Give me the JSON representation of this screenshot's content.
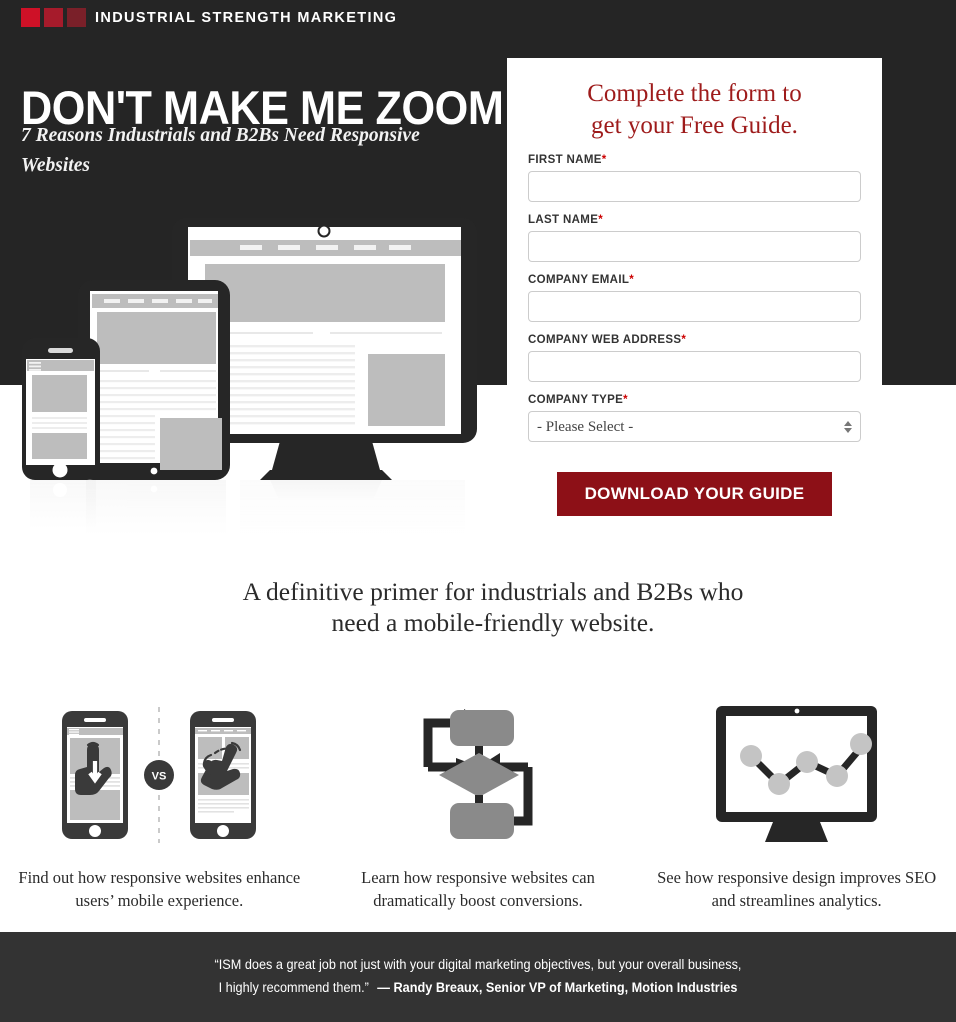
{
  "brand": {
    "name": "INDUSTRIAL STRENGTH MARKETING",
    "square_colors": [
      "#CE1127",
      "#A61B2B",
      "#7A2029"
    ],
    "header_bg": "#252525",
    "accent_red": "#9E1B1B",
    "button_red": "#8D1017",
    "footer_bg": "#333333"
  },
  "hero": {
    "title": "DON'T MAKE ME ZOOM",
    "subtitle": "7 Reasons Industrials and B2Bs Need Responsive Websites",
    "illustration_name": "responsive-devices-illustration"
  },
  "form": {
    "heading_line1": "Complete the form to",
    "heading_line2": "get your Free Guide.",
    "fields": [
      {
        "label": "FIRST NAME",
        "required": true,
        "type": "text",
        "value": "",
        "placeholder": ""
      },
      {
        "label": "LAST NAME",
        "required": true,
        "type": "text",
        "value": "",
        "placeholder": ""
      },
      {
        "label": "COMPANY EMAIL",
        "required": true,
        "type": "text",
        "value": "",
        "placeholder": ""
      },
      {
        "label": "COMPANY WEB ADDRESS",
        "required": true,
        "type": "text",
        "value": "",
        "placeholder": ""
      },
      {
        "label": "COMPANY TYPE",
        "required": true,
        "type": "select",
        "value": "- Please Select -",
        "placeholder": ""
      }
    ],
    "required_marker": "*",
    "select_options": [
      "- Please Select -"
    ],
    "submit_label": "DOWNLOAD YOUR GUIDE"
  },
  "tagline": "A definitive primer for industrials and B2Bs who need a mobile-friendly website.",
  "features": [
    {
      "icon": "phone-tap-vs-pinch-icon",
      "badge": "VS",
      "caption": "Find out how responsive websites enhance users’ mobile experience."
    },
    {
      "icon": "conversion-flowchart-icon",
      "badge": "",
      "caption": "Learn how responsive websites can dramatically boost conversions."
    },
    {
      "icon": "monitor-analytics-chart-icon",
      "badge": "",
      "caption": "See how responsive design improves SEO and streamlines analytics."
    }
  ],
  "footer": {
    "quote_line1": "“ISM does a great job not just with your digital marketing objectives, but your overall business,",
    "quote_line2": "I highly recommend them.”",
    "attribution": "— Randy Breaux, Senior VP of Marketing, Motion Industries"
  }
}
